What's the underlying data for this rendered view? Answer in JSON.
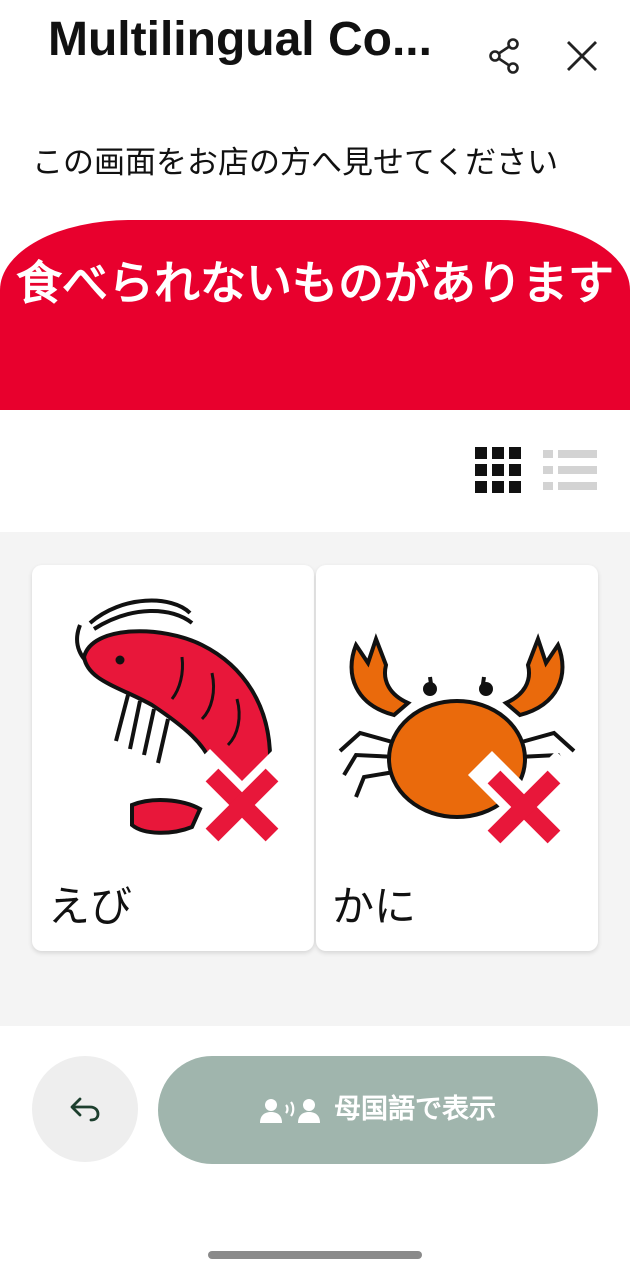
{
  "header": {
    "title": "Multilingual Co...",
    "share_icon": "share-icon",
    "close_icon": "close-icon"
  },
  "instruction": "この画面をお店の方へ見せてください",
  "banner": {
    "text": "食べられないものがあります",
    "color": "#e8002d"
  },
  "view_toggle": {
    "grid_icon": "grid-view-icon",
    "list_icon": "list-view-icon",
    "selected": "grid"
  },
  "cards": [
    {
      "label": "えび",
      "icon": "shrimp-icon",
      "status_icon": "red-cross-icon"
    },
    {
      "label": "かに",
      "icon": "crab-icon",
      "status_icon": "red-cross-icon"
    }
  ],
  "footer": {
    "back_icon": "undo-arrow-icon",
    "native_button_icon": "speaking-people-icon",
    "native_button_label": "母国語で表示"
  },
  "colors": {
    "accent_red": "#e8002d",
    "crab_orange": "#ea6a0c",
    "native_button_bg": "#a0b5ad",
    "cards_area_bg": "#f4f4f4"
  }
}
